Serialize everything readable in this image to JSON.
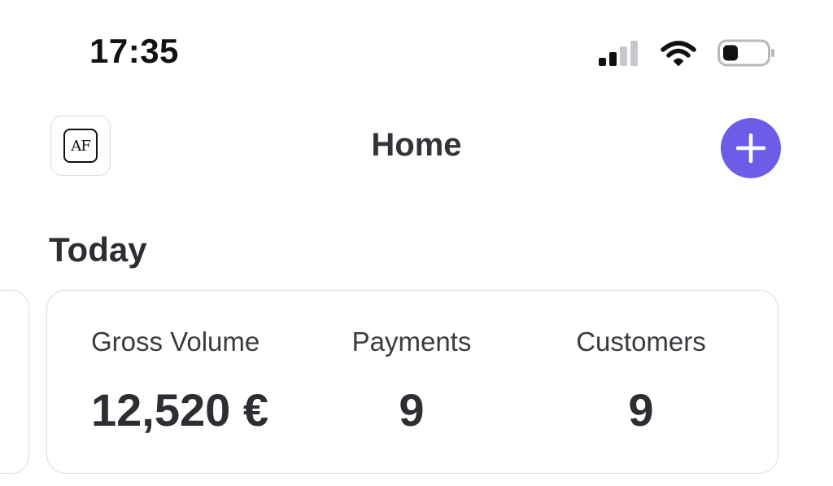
{
  "status_bar": {
    "time": "17:35",
    "icons": [
      "cellular-signal-icon",
      "wifi-icon",
      "battery-icon"
    ]
  },
  "header": {
    "logo_text": "AF",
    "title": "Home",
    "add_icon": "plus-icon",
    "accent_color": "#6c5ce7"
  },
  "today": {
    "section_title": "Today",
    "stats": [
      {
        "label": "Gross Volume",
        "value": "12,520 €"
      },
      {
        "label": "Payments",
        "value": "9"
      },
      {
        "label": "Customers",
        "value": "9"
      }
    ]
  }
}
